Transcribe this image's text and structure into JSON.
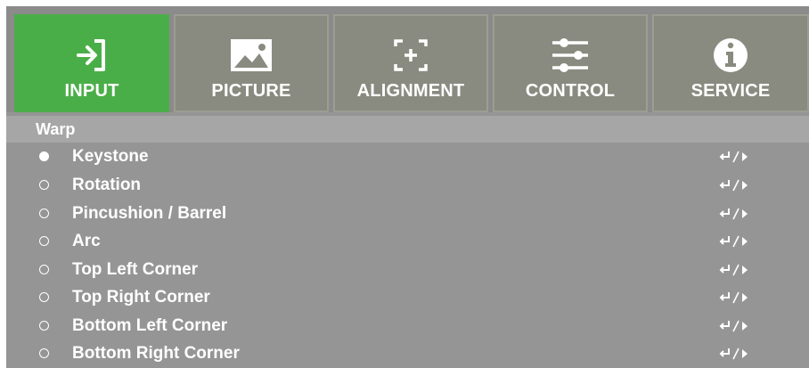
{
  "tabs": [
    {
      "label": "INPUT",
      "icon": "input-icon",
      "active": true
    },
    {
      "label": "PICTURE",
      "icon": "picture-icon",
      "active": false
    },
    {
      "label": "ALIGNMENT",
      "icon": "alignment-icon",
      "active": false
    },
    {
      "label": "CONTROL",
      "icon": "control-sliders-icon",
      "active": false
    },
    {
      "label": "SERVICE",
      "icon": "info-icon",
      "active": false
    }
  ],
  "section": {
    "title": "Warp"
  },
  "items": [
    {
      "label": "Keystone",
      "selected": true,
      "icon": "enter-right-icon"
    },
    {
      "label": "Rotation",
      "selected": false,
      "icon": "enter-right-icon"
    },
    {
      "label": "Pincushion / Barrel",
      "selected": false,
      "icon": "enter-right-icon"
    },
    {
      "label": "Arc",
      "selected": false,
      "icon": "enter-right-icon"
    },
    {
      "label": "Top Left Corner",
      "selected": false,
      "icon": "enter-right-icon"
    },
    {
      "label": "Top Right Corner",
      "selected": false,
      "icon": "enter-right-icon"
    },
    {
      "label": "Bottom Left Corner",
      "selected": false,
      "icon": "enter-right-icon"
    },
    {
      "label": "Bottom Right Corner",
      "selected": false,
      "icon": "enter-right-icon"
    }
  ],
  "colors": {
    "active_tab": "#4aae48",
    "tab_bg": "#8a8b80",
    "menu_bg": "#959595",
    "section_bg": "#a6a6a6"
  }
}
